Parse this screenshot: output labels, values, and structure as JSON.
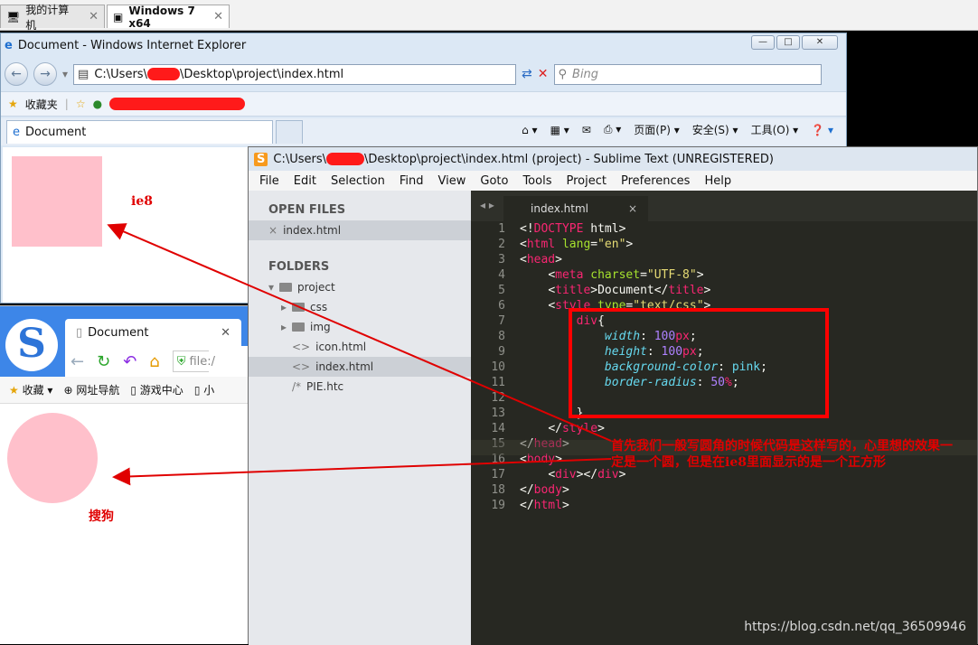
{
  "vm_tabs": [
    {
      "label": "我的计算机",
      "icon": "computer-icon",
      "active": false
    },
    {
      "label": "Windows 7 x64",
      "icon": "vm-icon",
      "active": true
    }
  ],
  "ie": {
    "title": "Document - Windows Internet Explorer",
    "window_buttons": [
      "—",
      "□",
      "✕"
    ],
    "url": "C:\\Users\\",
    "url_tail": "\\Desktop\\project\\index.html",
    "search_placeholder": "Bing",
    "favorites_label": "收藏夹",
    "tab_label": "Document",
    "commands": [
      "页面(P) ▾",
      "安全(S) ▾",
      "工具(O) ▾"
    ],
    "content_label": "ie8"
  },
  "sogou": {
    "tab_label": "Document",
    "url_text": "file:/",
    "fav_items": [
      "收藏",
      "网址导航",
      "游戏中心",
      "小"
    ],
    "content_label": "搜狗"
  },
  "sublime": {
    "title_head": "C:\\Users\\",
    "title_tail": "\\Desktop\\project\\index.html (project) - Sublime Text (UNREGISTERED)",
    "menu": [
      "File",
      "Edit",
      "Selection",
      "Find",
      "View",
      "Goto",
      "Tools",
      "Project",
      "Preferences",
      "Help"
    ],
    "open_files_header": "OPEN FILES",
    "open_file": "index.html",
    "folders_header": "FOLDERS",
    "tree": [
      {
        "label": "project",
        "kind": "folder-open"
      },
      {
        "label": "css",
        "kind": "folder"
      },
      {
        "label": "img",
        "kind": "folder"
      },
      {
        "label": "icon.html",
        "kind": "file"
      },
      {
        "label": "index.html",
        "kind": "file",
        "selected": true
      },
      {
        "label": "PIE.htc",
        "kind": "comment-file"
      }
    ],
    "tab_label": "index.html",
    "line_numbers": [
      "1",
      "2",
      "3",
      "4",
      "5",
      "6",
      "7",
      "8",
      "9",
      "10",
      "11",
      "12",
      "13",
      "14",
      "15",
      "16",
      "17",
      "18",
      "19"
    ]
  },
  "annotation": "首先我们一般写圆角的时候代码是这样写的，心里想的效果一定是一个圆，但是在ie8里面显示的是一个正方形",
  "watermark": "https://blog.csdn.net/qq_36509946"
}
